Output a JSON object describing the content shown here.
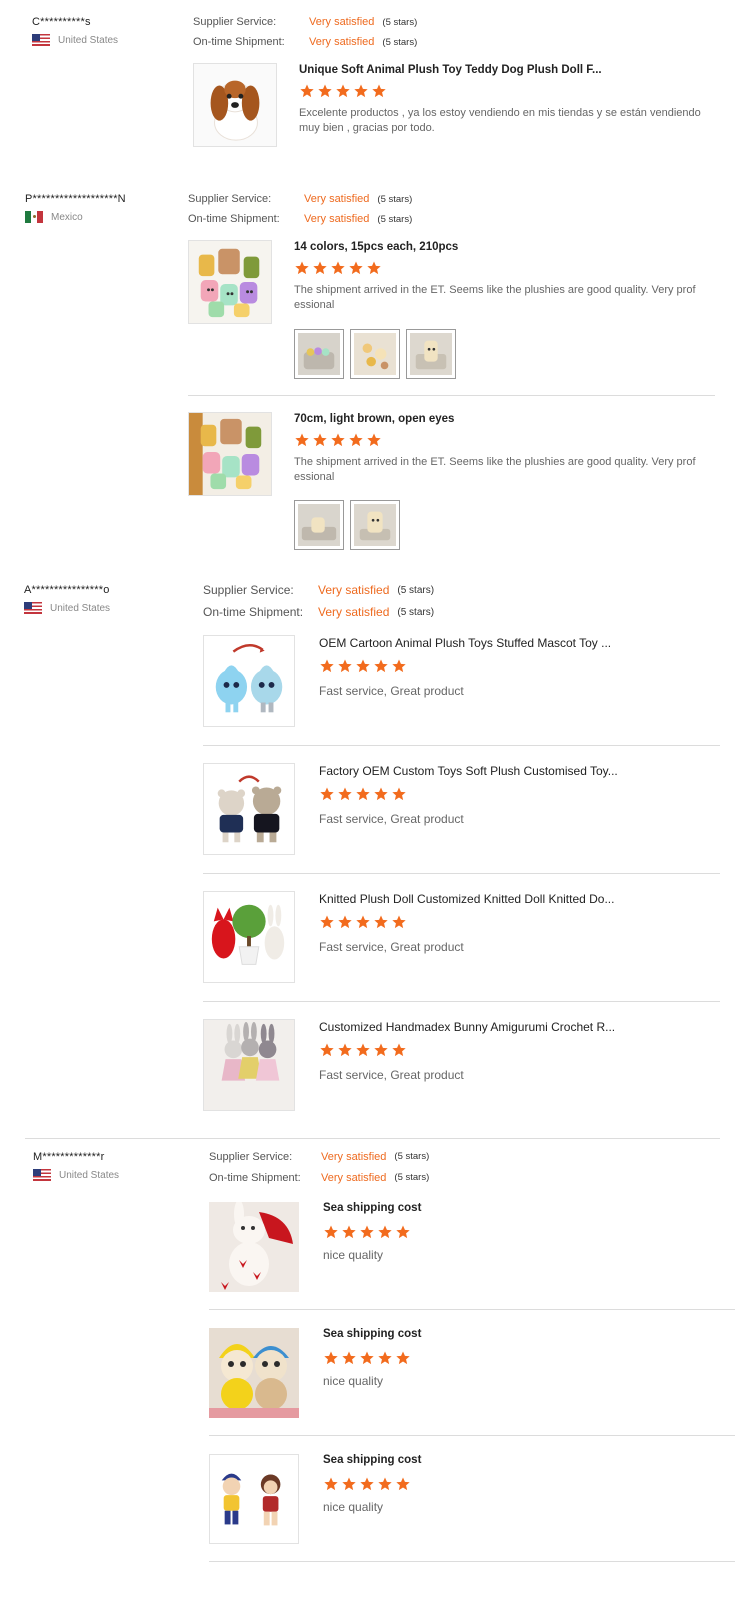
{
  "labels": {
    "supplier_service": "Supplier Service:",
    "ontime_shipment": "On-time Shipment:"
  },
  "reviews": [
    {
      "buyer": "C**********s",
      "country": "United States",
      "flag": "us-flag",
      "supplier_value": "Very satisfied",
      "supplier_stars": "(5 stars)",
      "shipment_value": "Very satisfied",
      "shipment_stars": "(5 stars)",
      "items": [
        {
          "title": "Unique Soft Animal Plush Toy Teddy Dog Plush Doll F...",
          "rating": 5,
          "text": "Excelente productos , ya los estoy vendiendo en mis tiendas y se están vendiendo muy bien , gracias por todo."
        }
      ]
    },
    {
      "buyer": "P*******************N",
      "country": "Mexico",
      "flag": "mexico-flag",
      "supplier_value": "Very satisfied",
      "supplier_stars": "(5 stars)",
      "shipment_value": "Very satisfied",
      "shipment_stars": "(5 stars)",
      "items": [
        {
          "title": "14 colors, 15pcs each, 210pcs",
          "rating": 5,
          "text": "The shipment arrived in the ET. Seems like the plushies are good quality. Very prof essional"
        },
        {
          "title": "70cm, light brown, open eyes",
          "rating": 5,
          "text": "The shipment arrived in the ET. Seems like the plushies are good quality. Very prof essional"
        }
      ]
    },
    {
      "buyer": "A****************o",
      "country": "United States",
      "flag": "us-flag",
      "supplier_value": "Very satisfied",
      "supplier_stars": "(5 stars)",
      "shipment_value": "Very satisfied",
      "shipment_stars": "(5 stars)",
      "items": [
        {
          "title": "OEM Cartoon Animal Plush Toys Stuffed Mascot Toy ...",
          "rating": 5,
          "text": "Fast service, Great product"
        },
        {
          "title": "Factory OEM Custom Toys Soft Plush Customised Toy...",
          "rating": 5,
          "text": "Fast service, Great product"
        },
        {
          "title": "Knitted Plush Doll Customized Knitted Doll Knitted Do...",
          "rating": 5,
          "text": "Fast service, Great product"
        },
        {
          "title": "Customized Handmadex Bunny Amigurumi Crochet R...",
          "rating": 5,
          "text": "Fast service, Great product"
        }
      ]
    },
    {
      "buyer": "M*************r",
      "country": "United States",
      "flag": "us-flag",
      "supplier_value": "Very satisfied",
      "supplier_stars": "(5 stars)",
      "shipment_value": "Very satisfied",
      "shipment_stars": "(5 stars)",
      "items": [
        {
          "title": "Sea shipping cost",
          "rating": 5,
          "text": "nice quality"
        },
        {
          "title": "Sea shipping cost",
          "rating": 5,
          "text": "nice quality"
        },
        {
          "title": "Sea shipping cost",
          "rating": 5,
          "text": "nice quality"
        }
      ]
    }
  ],
  "colors": {
    "accent": "#ee6a1f",
    "star": "#f26b1d",
    "divider": "#dcdcdc"
  }
}
